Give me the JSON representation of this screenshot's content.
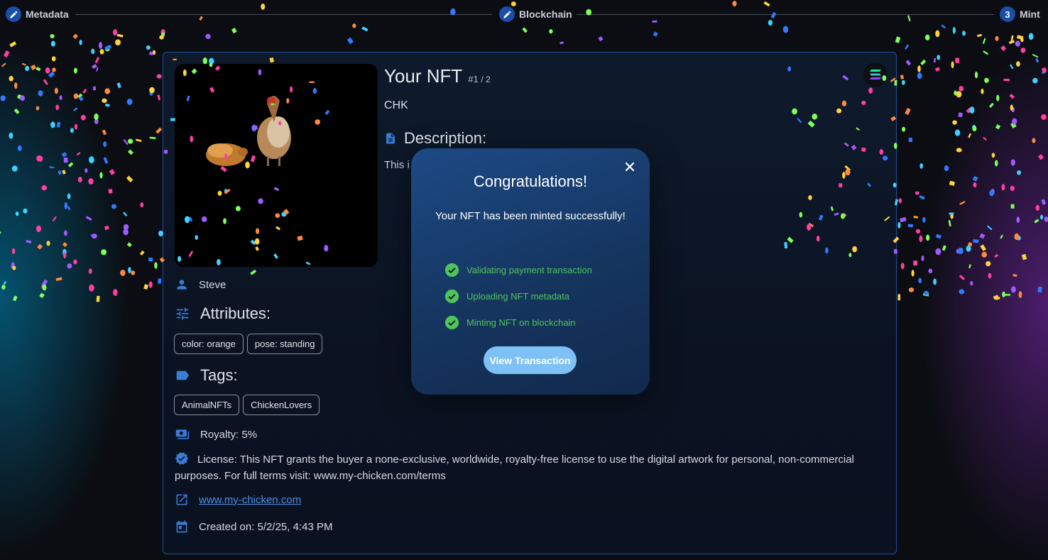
{
  "stepper": {
    "steps": [
      {
        "label": "Metadata",
        "icon": "pencil-icon",
        "state": "completed"
      },
      {
        "label": "Blockchain",
        "icon": "pencil-icon",
        "state": "completed"
      },
      {
        "label": "Mint",
        "number": "3",
        "state": "active"
      }
    ]
  },
  "nft": {
    "title": "Your NFT",
    "edition": "#1",
    "edition_total": "/ 2",
    "symbol": "CHK",
    "description_heading": "Description:",
    "description_text": "This i",
    "creator": "Steve",
    "attributes_heading": "Attributes:",
    "attributes": [
      "color: orange",
      "pose: standing"
    ],
    "tags_heading": "Tags:",
    "tags": [
      "AnimalNFTs",
      "ChickenLovers"
    ],
    "royalty": "Royalty: 5%",
    "license": "License: This NFT grants the buyer a none-exclusive, worldwide, royalty-free license to use the digital artwork for personal, non-commercial purposes. For full terms visit: www.my-chicken.com/terms",
    "website": "www.my-chicken.com",
    "created": "Created on: 5/2/25, 4:43 PM",
    "chain_icon": "solana-logo-icon"
  },
  "modal": {
    "title": "Congratulations!",
    "message": "Your NFT has been minted successfully!",
    "steps": [
      "Validating payment transaction",
      "Uploading NFT metadata",
      "Minting NFT on blockchain"
    ],
    "button_label": "View Transaction",
    "close_icon": "close-icon"
  },
  "colors": {
    "accent": "#3a7bd5",
    "success": "#4fc45a",
    "button": "#7ec1f7",
    "card_border": "#1e4f9c"
  }
}
